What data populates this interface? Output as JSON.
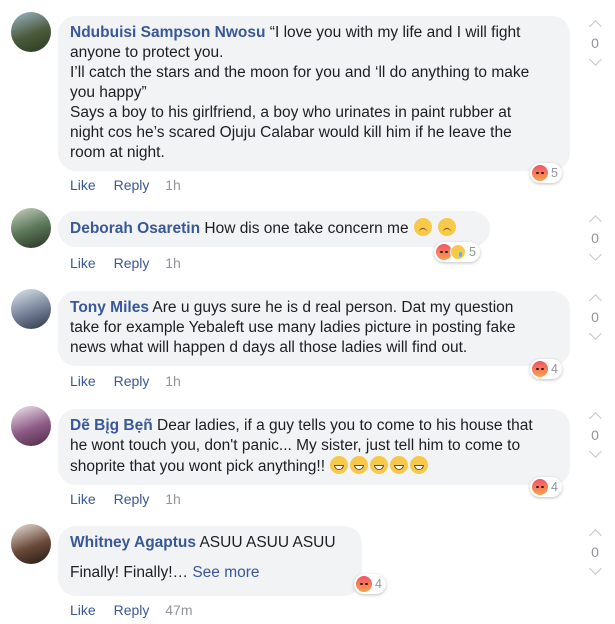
{
  "actions": {
    "like": "Like",
    "reply": "Reply"
  },
  "comments": [
    {
      "author": "Ndubuisi Sampson Nwosu",
      "text_lines": [
        "“I love you with my life and I will fight",
        "anyone to protect you.",
        "I’ll catch the stars and the moon for you and ‘ll do anything to make",
        "you happy”",
        "Says a boy to his girlfriend, a boy who urinates in paint rubber at",
        "night cos he’s scared Ojuju Calabar would kill him if he leave the",
        "room at night."
      ],
      "time": "1h",
      "reaction_count": "5",
      "reactions": [
        "angry-icon"
      ],
      "votes": "0"
    },
    {
      "author": "Deborah Osaretin",
      "text": "How dis one take concern me",
      "trailing_emojis": [
        "worried-face-icon",
        "worried-face-icon"
      ],
      "time": "1h",
      "reaction_count": "5",
      "reactions": [
        "angry-icon",
        "sad-icon"
      ],
      "votes": "0"
    },
    {
      "author": "Tony Miles",
      "text_lines": [
        "Are u guys sure he is d real person. Dat my question",
        "take for example Yebaleft use many ladies picture in posting fake",
        "news what will happen d days all those ladies will find out."
      ],
      "time": "1h",
      "reaction_count": "4",
      "reactions": [
        "angry-icon"
      ],
      "votes": "0"
    },
    {
      "author": "Dẽ Bįg Bẹñ",
      "text_lines": [
        "Dear ladies, if a guy tells you to come to his house that",
        "he wont touch you, don't panic... My sister, just tell him to come to",
        "shoprite that you wont pick anything!!"
      ],
      "trailing_emojis": [
        "grinning-face-icon",
        "grinning-face-icon",
        "grinning-face-icon",
        "grinning-face-icon",
        "grinning-face-icon"
      ],
      "time": "1h",
      "reaction_count": "4",
      "reactions": [
        "angry-icon"
      ],
      "votes": "0"
    },
    {
      "author": "Whitney Agaptus",
      "text": "ASUU ASUU ASUU",
      "text_line2": "Finally! Finally!…",
      "see_more": "See more",
      "time": "47m",
      "reaction_count": "4",
      "reactions": [
        "angry-icon"
      ],
      "votes": "0"
    }
  ]
}
